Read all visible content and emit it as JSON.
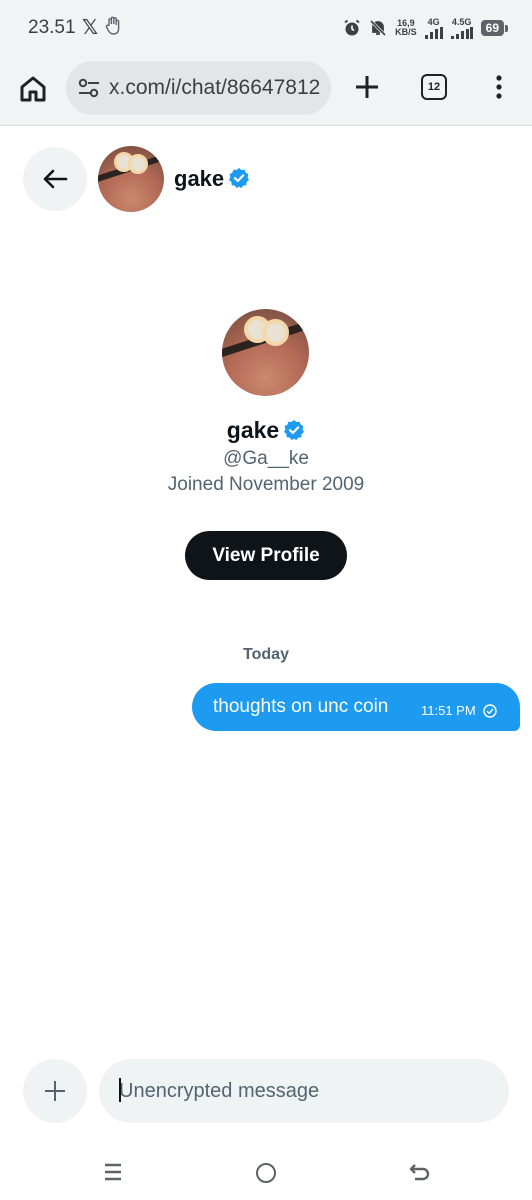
{
  "status_bar": {
    "time": "23.51",
    "x_glyph": "𝕏",
    "net_speed_top": "16,9",
    "net_speed_bottom": "KB/S",
    "sim1": "4G",
    "sim2": "4.5G",
    "battery": "69",
    "icons": [
      "x-logo-icon",
      "hand-icon",
      "alarm-icon",
      "mute-icon",
      "signal-icon",
      "signal-icon",
      "battery-icon"
    ]
  },
  "browser": {
    "url": "x.com/i/chat/86647812",
    "tab_count": "12",
    "icons": [
      "home-icon",
      "site-settings-icon",
      "new-tab-icon",
      "menu-icon"
    ]
  },
  "chat_header": {
    "name": "gake",
    "verified": true
  },
  "profile": {
    "name": "gake",
    "handle": "@Ga__ke",
    "joined": "Joined November 2009",
    "view_profile_label": "View Profile"
  },
  "messages": {
    "day_label": "Today",
    "items": [
      {
        "text": "thoughts on unc coin",
        "time": "11:51 PM",
        "from_me": true
      }
    ]
  },
  "composer": {
    "placeholder": "Unencrypted message"
  },
  "colors": {
    "accent": "#1d9bf0",
    "text": "#0f1419",
    "secondary": "#536471",
    "surface": "#eff3f4"
  }
}
